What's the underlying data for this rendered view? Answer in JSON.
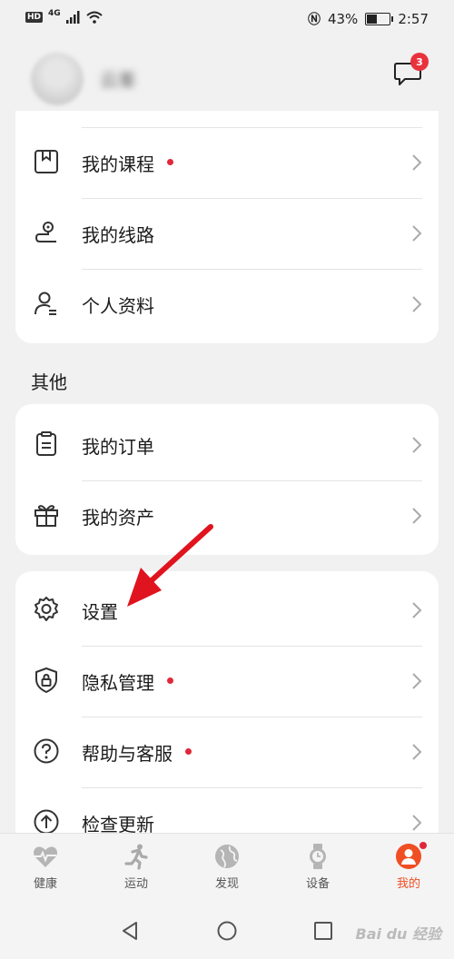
{
  "status_bar": {
    "hd": "HD",
    "network": "4G",
    "battery": "43%",
    "battery_level": 0.43,
    "time": "2:57"
  },
  "header": {
    "username": "云峯",
    "message_badge": "3"
  },
  "card1": {
    "items": [
      {
        "label": "我的课程",
        "icon": "course-icon",
        "dot": true
      },
      {
        "label": "我的线路",
        "icon": "route-icon",
        "dot": false
      },
      {
        "label": "个人资料",
        "icon": "profile-icon",
        "dot": false
      }
    ]
  },
  "section_other": {
    "title": "其他"
  },
  "card2": {
    "items": [
      {
        "label": "我的订单",
        "icon": "order-icon",
        "dot": false
      },
      {
        "label": "我的资产",
        "icon": "gift-icon",
        "dot": false
      }
    ]
  },
  "card3": {
    "items": [
      {
        "label": "设置",
        "icon": "gear-icon",
        "dot": false
      },
      {
        "label": "隐私管理",
        "icon": "privacy-shield-icon",
        "dot": true
      },
      {
        "label": "帮助与客服",
        "icon": "help-icon",
        "dot": true
      },
      {
        "label": "检查更新",
        "icon": "update-icon",
        "dot": false
      }
    ]
  },
  "tabbar": {
    "tabs": [
      {
        "label": "健康",
        "icon": "heart-icon",
        "active": false
      },
      {
        "label": "运动",
        "icon": "runner-icon",
        "active": false
      },
      {
        "label": "发现",
        "icon": "globe-icon",
        "active": false
      },
      {
        "label": "设备",
        "icon": "watch-icon",
        "active": false
      },
      {
        "label": "我的",
        "icon": "user-icon",
        "active": true
      }
    ]
  },
  "watermark": "Bai du 经验",
  "colors": {
    "accent": "#f04e23",
    "badge_red": "#e8323c",
    "dot_red": "#e0283a",
    "arrow_red": "#e0141e"
  }
}
